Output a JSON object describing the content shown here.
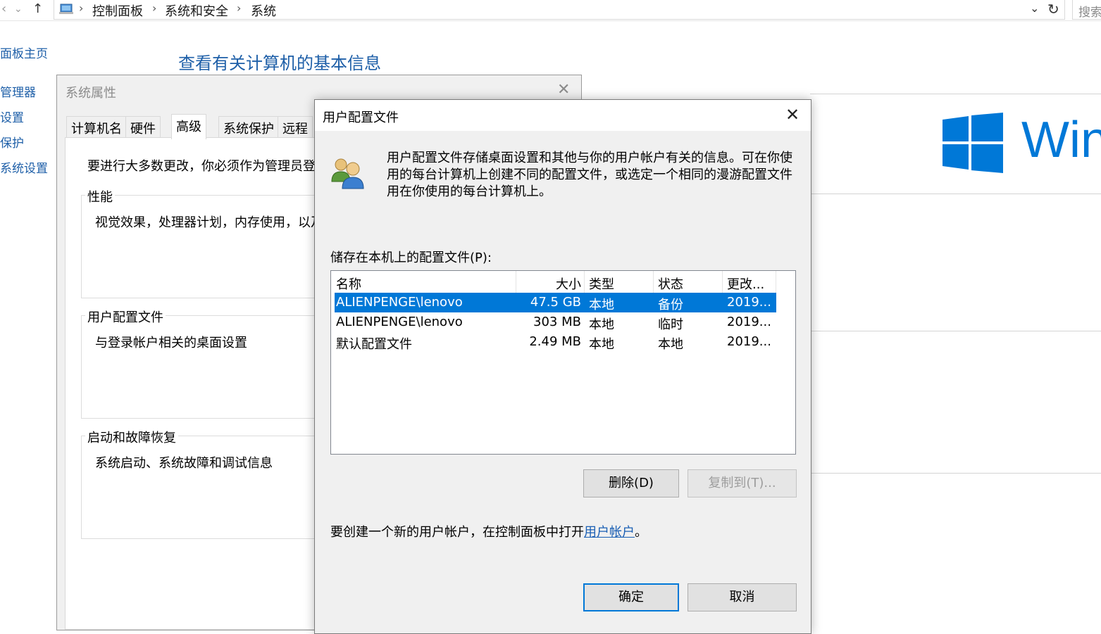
{
  "explorer": {
    "breadcrumb": [
      "控制面板",
      "系统和安全",
      "系统"
    ],
    "search_placeholder": "搜索"
  },
  "control_panel": {
    "left_nav": [
      "面板主页",
      "管理器",
      "设置",
      "保护",
      "系统设置"
    ],
    "page_title": "查看有关计算机的基本信息",
    "windows_word": "Win"
  },
  "system_properties": {
    "title": "系统属性",
    "tabs": [
      "计算机名",
      "硬件",
      "高级",
      "系统保护",
      "远程"
    ],
    "active_tab": "高级",
    "admin_message": "要进行大多数更改，你必须作为管理员登",
    "groups": [
      {
        "title": "性能",
        "desc": "视觉效果，处理器计划，内存使用，以及"
      },
      {
        "title": "用户配置文件",
        "desc": "与登录帐户相关的桌面设置"
      },
      {
        "title": "启动和故障恢复",
        "desc": "系统启动、系统故障和调试信息"
      }
    ]
  },
  "user_profiles_dialog": {
    "title": "用户配置文件",
    "description": "用户配置文件存储桌面设置和其他与你的用户帐户有关的信息。可在你使用的每台计算机上创建不同的配置文件，或选定一个相同的漫游配置文件用在你使用的每台计算机上。",
    "list_label": "储存在本机上的配置文件(P):",
    "columns": [
      "名称",
      "大小",
      "类型",
      "状态",
      "更改..."
    ],
    "rows": [
      {
        "name": "ALIENPENGE\\lenovo",
        "size": "47.5 GB",
        "type": "本地",
        "status": "备份",
        "modified": "2019...",
        "selected": true
      },
      {
        "name": "ALIENPENGE\\lenovo",
        "size": "303 MB",
        "type": "本地",
        "status": "临时",
        "modified": "2019...",
        "selected": false
      },
      {
        "name": "默认配置文件",
        "size": "2.49 MB",
        "type": "本地",
        "status": "本地",
        "modified": "2019...",
        "selected": false
      }
    ],
    "delete_button": "删除(D)",
    "copy_button": "复制到(T)...",
    "create_note_prefix": "要创建一个新的用户帐户，在控制面板中打开",
    "create_note_link": "用户帐户",
    "create_note_suffix": "。",
    "ok_button": "确定",
    "cancel_button": "取消"
  },
  "colors": {
    "accent": "#0078d7",
    "link": "#1e5fa8",
    "dialog_bg": "#f0f0f0"
  }
}
